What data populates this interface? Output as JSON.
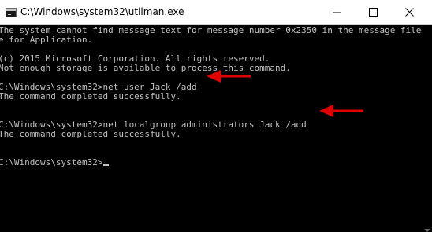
{
  "window": {
    "title": "C:\\Windows\\system32\\utilman.exe",
    "icon": "command-prompt-icon",
    "controls": [
      "minimize-icon",
      "maximize-icon",
      "close-icon"
    ]
  },
  "console": {
    "lines": [
      "The system cannot find message text for message number 0x2350 in the message file",
      "e for Application.",
      "",
      "(c) 2015 Microsoft Corporation. All rights reserved.",
      "Not enough storage is available to process this command.",
      "",
      "C:\\Windows\\system32>net user Jack /add",
      "The command completed successfully.",
      "",
      "",
      "C:\\Windows\\system32>net localgroup administrators Jack /add",
      "The command completed successfully.",
      "",
      "",
      "C:\\Windows\\system32>"
    ],
    "text_color": "#c0c0c0",
    "background": "#000000"
  },
  "annotations": {
    "arrow_color": "#e00000",
    "arrows": [
      "red-arrow-icon",
      "red-arrow-icon"
    ]
  }
}
